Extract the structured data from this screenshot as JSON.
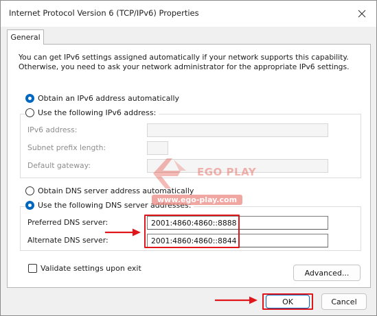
{
  "window": {
    "title": "Internet Protocol Version 6 (TCP/IPv6) Properties"
  },
  "tabs": [
    {
      "label": "General",
      "selected": true
    }
  ],
  "general": {
    "description_line1": "You can get IPv6 settings assigned automatically if your network supports this capability.",
    "description_line2": "Otherwise, you need to ask your network administrator for the appropriate IPv6 settings.",
    "address": {
      "auto_label": "Obtain an IPv6 address automatically",
      "auto_selected": true,
      "manual_label": "Use the following IPv6 address:",
      "manual_selected": false,
      "ipv6_address_label": "IPv6 address:",
      "ipv6_address_value": "",
      "subnet_prefix_label": "Subnet prefix length:",
      "subnet_prefix_value": "",
      "gateway_label": "Default gateway:",
      "gateway_value": ""
    },
    "dns": {
      "auto_label": "Obtain DNS server address automatically",
      "auto_selected": false,
      "manual_label": "Use the following DNS server addresses:",
      "manual_selected": true,
      "preferred_label": "Preferred DNS server:",
      "preferred_value": "2001:4860:4860::8888",
      "alternate_label": "Alternate DNS server:",
      "alternate_value": "2001:4860:4860::8844"
    },
    "validate_label": "Validate settings upon exit",
    "validate_checked": false,
    "advanced_label": "Advanced..."
  },
  "buttons": {
    "ok": "OK",
    "cancel": "Cancel"
  },
  "watermark": {
    "brand": "EGO PLAY",
    "url": "www.ego-play.com"
  },
  "colors": {
    "accent": "#0067c0",
    "annotation": "#e0161b"
  }
}
